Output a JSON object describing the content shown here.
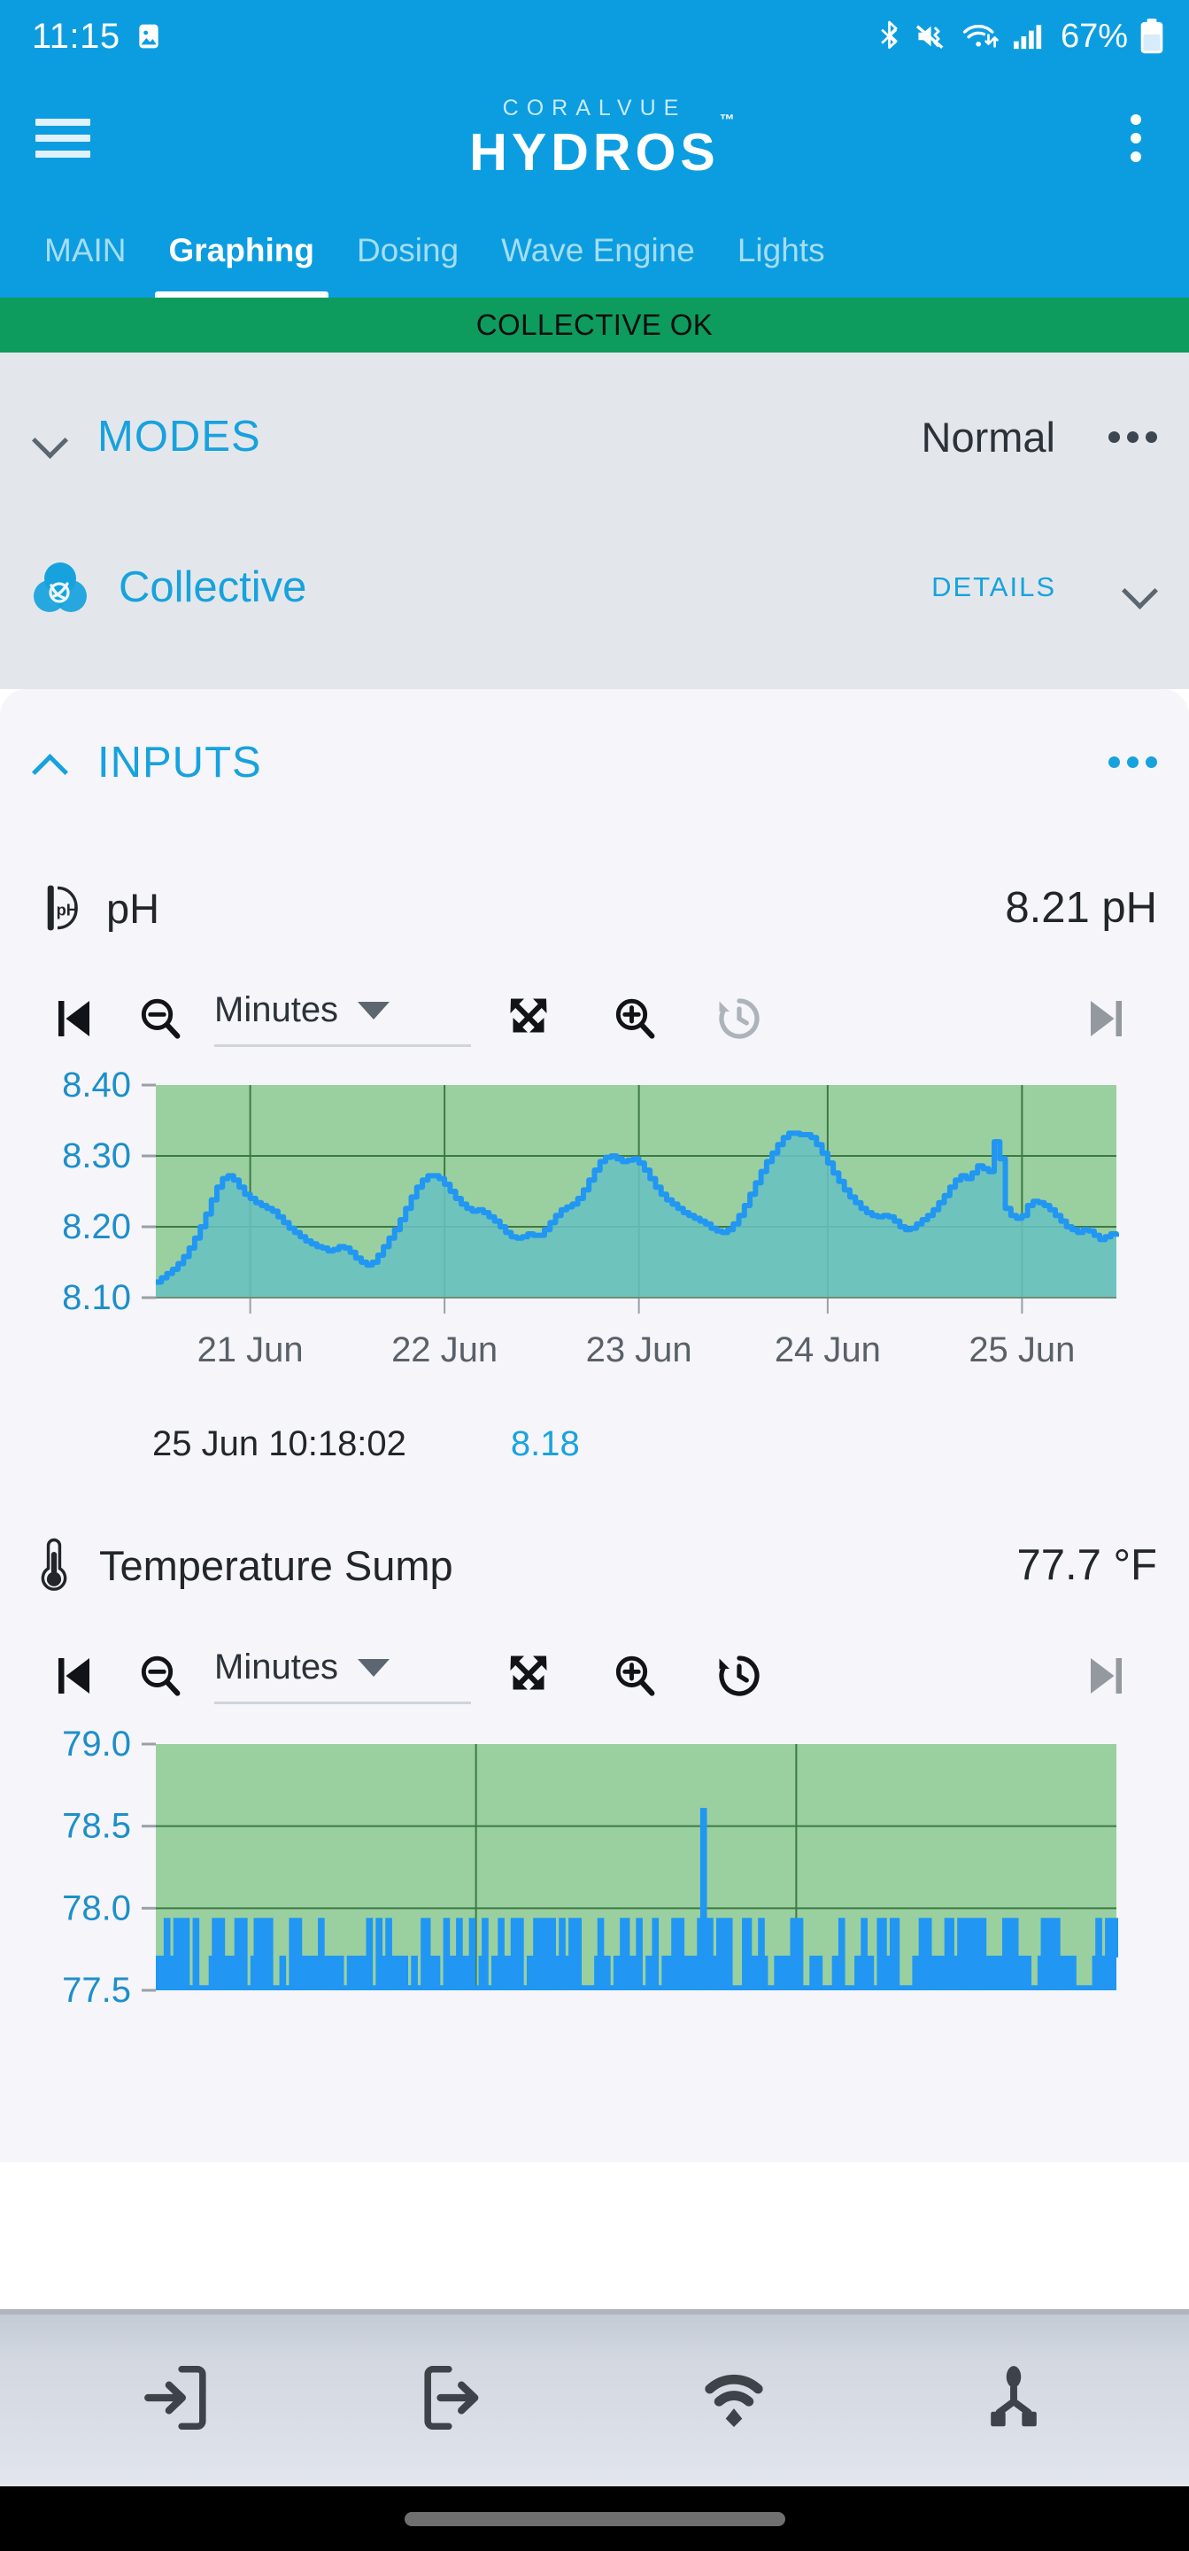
{
  "status_bar": {
    "time": "11:15",
    "battery_percent": "67%",
    "icons": [
      "image-icon",
      "bluetooth-icon",
      "mute-vibrate-icon",
      "wifi-icon",
      "cellular-signal-icon",
      "battery-icon"
    ]
  },
  "app_bar": {
    "menu_icon": "hamburger-menu-icon",
    "brand_top": "CORALVUE",
    "brand_main": "HYDROS",
    "brand_tm": "™",
    "overflow_icon": "kebab-menu-icon"
  },
  "tabs": {
    "items": [
      {
        "label": "MAIN",
        "active": false
      },
      {
        "label": "Graphing",
        "active": true
      },
      {
        "label": "Dosing",
        "active": false
      },
      {
        "label": "Wave Engine",
        "active": false
      },
      {
        "label": "Lights",
        "active": false
      }
    ]
  },
  "banner": {
    "text": "COLLECTIVE OK",
    "color": "#0d9b5e"
  },
  "modes": {
    "title": "MODES",
    "value": "Normal",
    "chevron": "chevron-down-icon",
    "overflow_icon": "kebab-menu-icon"
  },
  "collective": {
    "name": "Collective",
    "icon": "collective-circles-icon",
    "details_label": "DETAILS",
    "chevron": "chevron-down-icon"
  },
  "inputs": {
    "title": "INPUTS",
    "chevron": "chevron-up-icon",
    "overflow_icon": "kebab-menu-icon"
  },
  "toolbar": {
    "skip_start_icon": "skip-to-start-icon",
    "zoom_out_icon": "zoom-out-icon",
    "interval_value": "Minutes",
    "caret_icon": "chevron-down-icon",
    "fit_icon": "fit-to-screen-icon",
    "zoom_in_icon": "zoom-in-icon",
    "history_icon": "history-restore-icon",
    "skip_end_icon": "skip-to-end-icon"
  },
  "colors": {
    "accent": "#0c9de0",
    "banner_green": "#0d9b5e",
    "chart_line": "#2196f3",
    "chart_ok_band": "#9ad0a0",
    "chart_fill": "#69c0c0",
    "axis_label": "#1d8fc9",
    "panel_bg": "#e3e7ec",
    "card_bg": "#f5f5fa"
  },
  "sensors": [
    {
      "icon": "ph-probe-icon",
      "name": "pH",
      "value": "8.21 pH",
      "readout_timestamp": "25 Jun 10:18:02",
      "readout_value": "8.18",
      "history_enabled": false
    },
    {
      "icon": "thermometer-icon",
      "name": "Temperature Sump",
      "value": "77.7 °F",
      "history_enabled": true
    }
  ],
  "chart_data": [
    {
      "type": "area",
      "title": "pH",
      "xlabel": "",
      "ylabel": "pH",
      "ylim": [
        8.1,
        8.4
      ],
      "yticks": [
        "8.10",
        "8.20",
        "8.30",
        "8.40"
      ],
      "xticks": [
        "21 Jun",
        "22 Jun",
        "23 Jun",
        "24 Jun",
        "25 Jun"
      ],
      "grid": true,
      "legend": "none",
      "ok_band": [
        8.2,
        8.4
      ],
      "series": [
        {
          "name": "pH",
          "values": [
            8.122,
            8.128,
            8.134,
            8.14,
            8.148,
            8.158,
            8.17,
            8.184,
            8.2,
            8.218,
            8.238,
            8.256,
            8.268,
            8.272,
            8.266,
            8.256,
            8.246,
            8.24,
            8.234,
            8.23,
            8.226,
            8.222,
            8.214,
            8.206,
            8.198,
            8.192,
            8.186,
            8.18,
            8.176,
            8.172,
            8.17,
            8.166,
            8.168,
            8.172,
            8.17,
            8.164,
            8.156,
            8.15,
            8.146,
            8.15,
            8.16,
            8.172,
            8.184,
            8.196,
            8.21,
            8.226,
            8.242,
            8.256,
            8.266,
            8.272,
            8.272,
            8.268,
            8.26,
            8.25,
            8.24,
            8.232,
            8.226,
            8.222,
            8.224,
            8.22,
            8.214,
            8.208,
            8.2,
            8.192,
            8.186,
            8.184,
            8.186,
            8.19,
            8.188,
            8.188,
            8.196,
            8.206,
            8.216,
            8.224,
            8.228,
            8.232,
            8.24,
            8.252,
            8.266,
            8.28,
            8.292,
            8.298,
            8.3,
            8.296,
            8.292,
            8.294,
            8.296,
            8.29,
            8.28,
            8.268,
            8.256,
            8.246,
            8.238,
            8.232,
            8.226,
            8.22,
            8.216,
            8.212,
            8.208,
            8.204,
            8.198,
            8.194,
            8.192,
            8.196,
            8.204,
            8.216,
            8.23,
            8.246,
            8.262,
            8.278,
            8.292,
            8.304,
            8.316,
            8.326,
            8.332,
            8.332,
            8.33,
            8.33,
            8.326,
            8.316,
            8.304,
            8.29,
            8.276,
            8.264,
            8.252,
            8.242,
            8.234,
            8.226,
            8.22,
            8.216,
            8.214,
            8.216,
            8.214,
            8.208,
            8.2,
            8.196,
            8.198,
            8.204,
            8.21,
            8.216,
            8.224,
            8.234,
            8.244,
            8.256,
            8.266,
            8.272,
            8.268,
            8.276,
            8.286,
            8.282,
            8.278,
            8.32,
            8.296,
            8.226,
            8.216,
            8.212,
            8.216,
            8.23,
            8.236,
            8.234,
            8.23,
            8.224,
            8.216,
            8.208,
            8.2,
            8.196,
            8.192,
            8.196,
            8.194,
            8.188,
            8.182,
            8.186,
            8.19,
            8.186
          ]
        }
      ]
    },
    {
      "type": "area",
      "title": "Temperature Sump",
      "xlabel": "",
      "ylabel": "°F",
      "ylim": [
        77.5,
        79.0
      ],
      "yticks": [
        "77.5",
        "78.0",
        "78.5",
        "79.0"
      ],
      "xticks": [],
      "grid": true,
      "legend": "none",
      "ok_band": [
        77.5,
        79.0
      ],
      "note": "dense square-wave oscillation between 77.5 and 77.95 with one spike to 78.6",
      "series": [
        {
          "name": "Temperature Sump",
          "band_low": 77.5,
          "band_high": 77.95,
          "spike_value": 78.6,
          "spike_x_fraction": 0.57
        }
      ]
    }
  ],
  "bottom_nav": {
    "items": [
      {
        "icon": "login-arrow-icon",
        "name": "nav-import"
      },
      {
        "icon": "logout-arrow-icon",
        "name": "nav-export"
      },
      {
        "icon": "wifi-cast-icon",
        "name": "nav-wifi"
      },
      {
        "icon": "share-nodes-icon",
        "name": "nav-share"
      }
    ],
    "gesture_bar": "gesture-handle"
  }
}
